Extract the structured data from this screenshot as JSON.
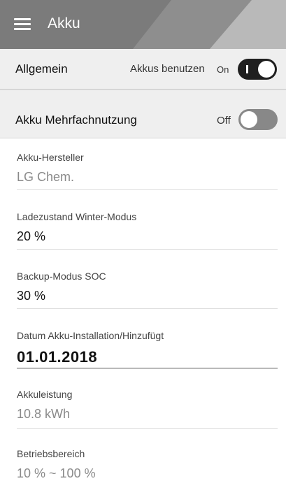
{
  "header": {
    "title": "Akku",
    "menu_icon": "hamburger-menu-icon"
  },
  "general": {
    "title": "Allgemein",
    "toggle_label": "Akkus benutzen",
    "state": "On",
    "enabled": true
  },
  "multi_use": {
    "title": "Akku Mehrfachnutzung",
    "state": "Off",
    "enabled": false
  },
  "fields": {
    "manufacturer": {
      "label": "Akku-Hersteller",
      "value": "LG Chem."
    },
    "winter_soc": {
      "label": "Ladezustand Winter-Modus",
      "value": "20 %"
    },
    "backup_soc": {
      "label": "Backup-Modus SOC",
      "value": "30 %"
    },
    "install_date": {
      "label": "Datum Akku-Installation/Hinzufügt",
      "value": "01.01.2018"
    },
    "capacity": {
      "label": "Akkuleistung",
      "value": "10.8 kWh"
    },
    "range": {
      "label": "Betriebsbereich",
      "value": "10 % ~ 100 %"
    }
  }
}
